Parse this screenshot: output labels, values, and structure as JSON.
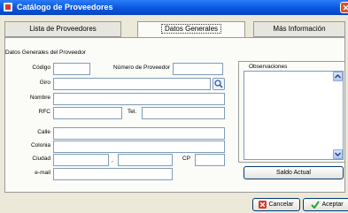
{
  "window": {
    "title": "Catálogo de Proveedores",
    "close_icon": "close-icon"
  },
  "tabs": [
    {
      "label": "Lista de Proveedores",
      "active": false
    },
    {
      "label": "Datos Generales",
      "active": true
    },
    {
      "label": "Más Información",
      "active": false
    }
  ],
  "section_title": "Datos Generales del Proveedor",
  "form": {
    "codigo_label": "Código",
    "numero_label": "Número de Proveedor",
    "giro_label": "Giro",
    "nombre_label": "Nombre",
    "rfc_label": "RFC",
    "tel_label": "Tel.",
    "calle_label": "Calle",
    "colonia_label": "Colonia",
    "ciudad_label": "Ciudad",
    "separator": ",",
    "cp_label": "CP",
    "email_label": "e-mail"
  },
  "observaciones": {
    "label": "Observaciones"
  },
  "buttons": {
    "saldo_actual": "Saldo Actual",
    "cancelar": "Cancelar",
    "aceptar": "Aceptar"
  },
  "colors": {
    "titlebar": "#0a56dd",
    "cancel_icon": "#d43b2a",
    "accept_icon": "#2aa52a"
  }
}
